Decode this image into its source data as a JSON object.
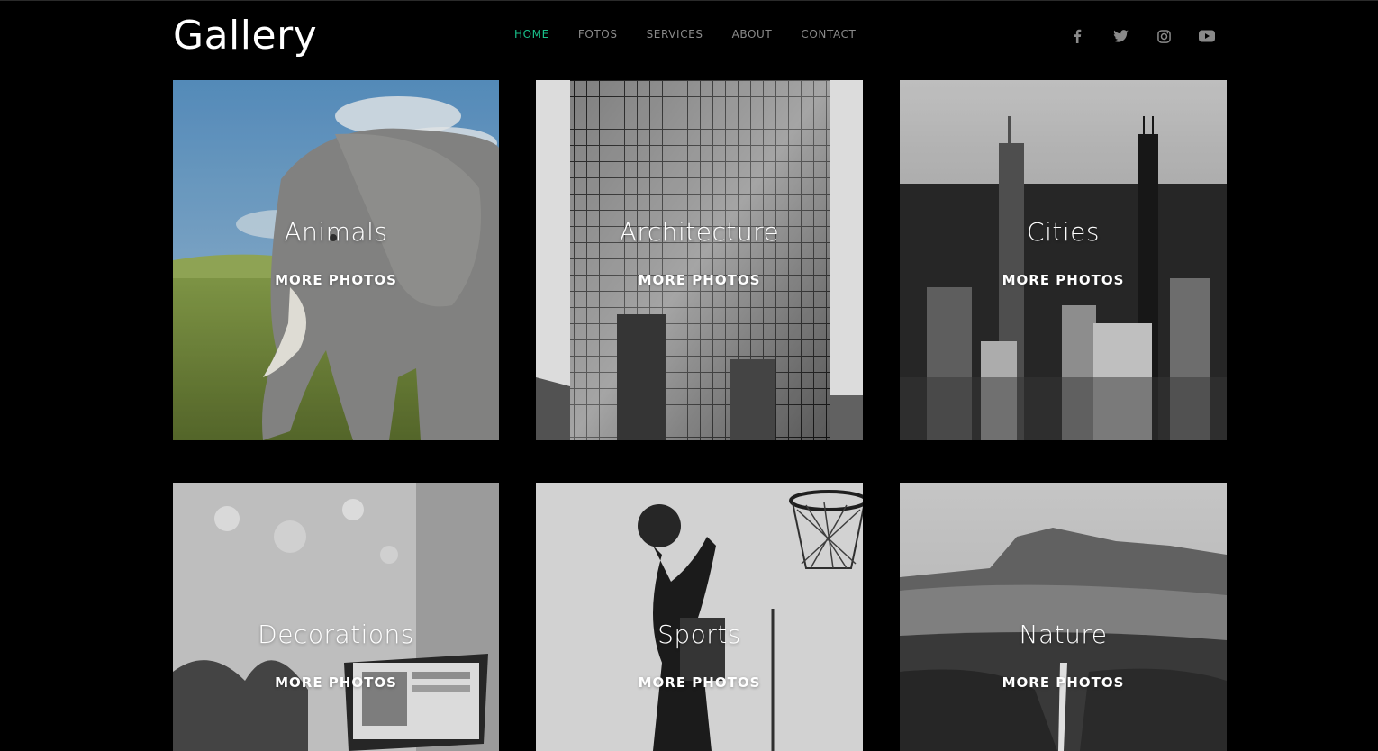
{
  "brand": {
    "name": "Gallery"
  },
  "nav": {
    "active_color": "#19c08a",
    "items": [
      {
        "label": "HOME",
        "active": true
      },
      {
        "label": "FOTOS",
        "active": false
      },
      {
        "label": "SERVICES",
        "active": false
      },
      {
        "label": "ABOUT",
        "active": false
      },
      {
        "label": "CONTACT",
        "active": false
      }
    ]
  },
  "social": [
    {
      "icon": "facebook-icon"
    },
    {
      "icon": "twitter-icon"
    },
    {
      "icon": "instagram-icon"
    },
    {
      "icon": "youtube-icon"
    }
  ],
  "gallery": {
    "cards": [
      {
        "title": "Animals",
        "link": "MORE PHOTOS",
        "image": "elephant-in-grass-photo"
      },
      {
        "title": "Architecture",
        "link": "MORE PHOTOS",
        "image": "glass-skyscraper-photo"
      },
      {
        "title": "Cities",
        "link": "MORE PHOTOS",
        "image": "city-skyline-photo"
      },
      {
        "title": "Decorations",
        "link": "MORE PHOTOS",
        "image": "laptop-and-plants-photo"
      },
      {
        "title": "Sports",
        "link": "MORE PHOTOS",
        "image": "basketball-dunk-photo"
      },
      {
        "title": "Nature",
        "link": "MORE PHOTOS",
        "image": "mountain-waterfall-photo"
      }
    ]
  }
}
